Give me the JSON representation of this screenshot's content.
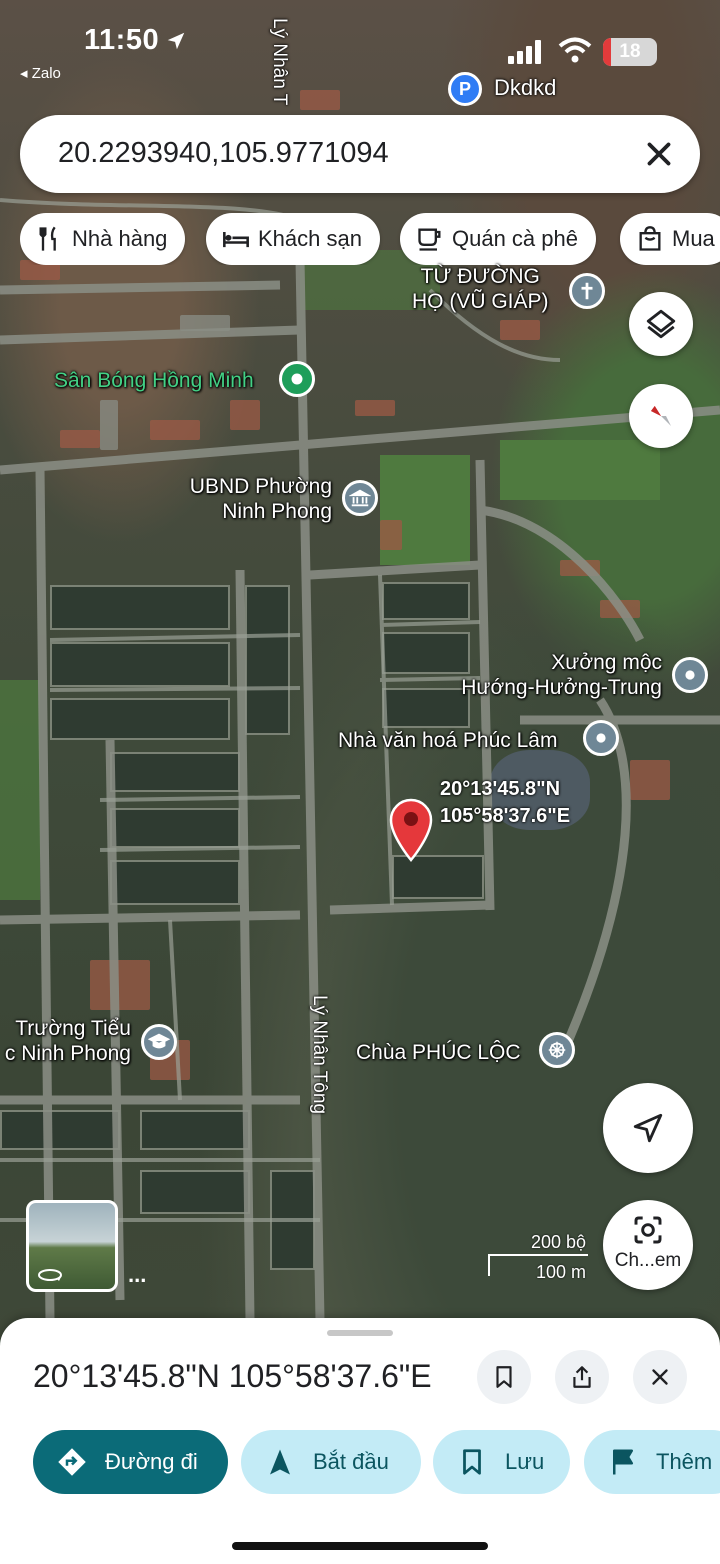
{
  "status_bar": {
    "time": "11:50",
    "back_app": "◂ Zalo",
    "battery": "18",
    "colors": {
      "battery_level": "#e23b3b"
    }
  },
  "search": {
    "value": "20.2293940,105.9771094",
    "clear_icon": "close-icon"
  },
  "chips": [
    {
      "label": "Nhà hàng",
      "icon": "restaurant-icon"
    },
    {
      "label": "Khách sạn",
      "icon": "hotel-icon"
    },
    {
      "label": "Quán cà phê",
      "icon": "coffee-icon"
    },
    {
      "label": "Mua",
      "icon": "shopping-bag-icon"
    }
  ],
  "map": {
    "labels": {
      "dkdkd": "Dkdkd",
      "church": "TỪ ĐƯỜNG\nHỌ (VŨ GIÁP)",
      "stadium": "Sân Bóng Hồng Minh",
      "ubnd": "UBND Phường\nNinh Phong",
      "workshop": "Xưởng mộc\nHướng-Hưởng-Trung",
      "culture_house": "Nhà văn hoá Phúc Lâm",
      "school": "Trường Tiểu\nc Ninh Phong",
      "pagoda": "Chùa PHÚC LỘC",
      "street_top": "Lý Nhân T",
      "street_bottom": "Lý Nhân Tông"
    },
    "pin": {
      "lat_label": "20°13'45.8\"N",
      "lng_label": "105°58'37.6\"E"
    },
    "scale": {
      "top": "200 bộ",
      "bottom": "100 m"
    },
    "lens_label": "Ch...em",
    "colors": {
      "pin": "#e5383b",
      "green_label": "#43d185"
    }
  },
  "sheet": {
    "title": "20°13'45.8\"N 105°58'37.6\"E",
    "actions": [
      {
        "label": "Đường đi",
        "icon": "directions-icon"
      },
      {
        "label": "Bắt đầu",
        "icon": "navigation-arrow-icon"
      },
      {
        "label": "Lưu",
        "icon": "bookmark-icon"
      },
      {
        "label": "Thêm",
        "icon": "flag-icon"
      }
    ],
    "colors": {
      "primary": "#0b6b78",
      "secondary": "#c3ebf6"
    }
  }
}
